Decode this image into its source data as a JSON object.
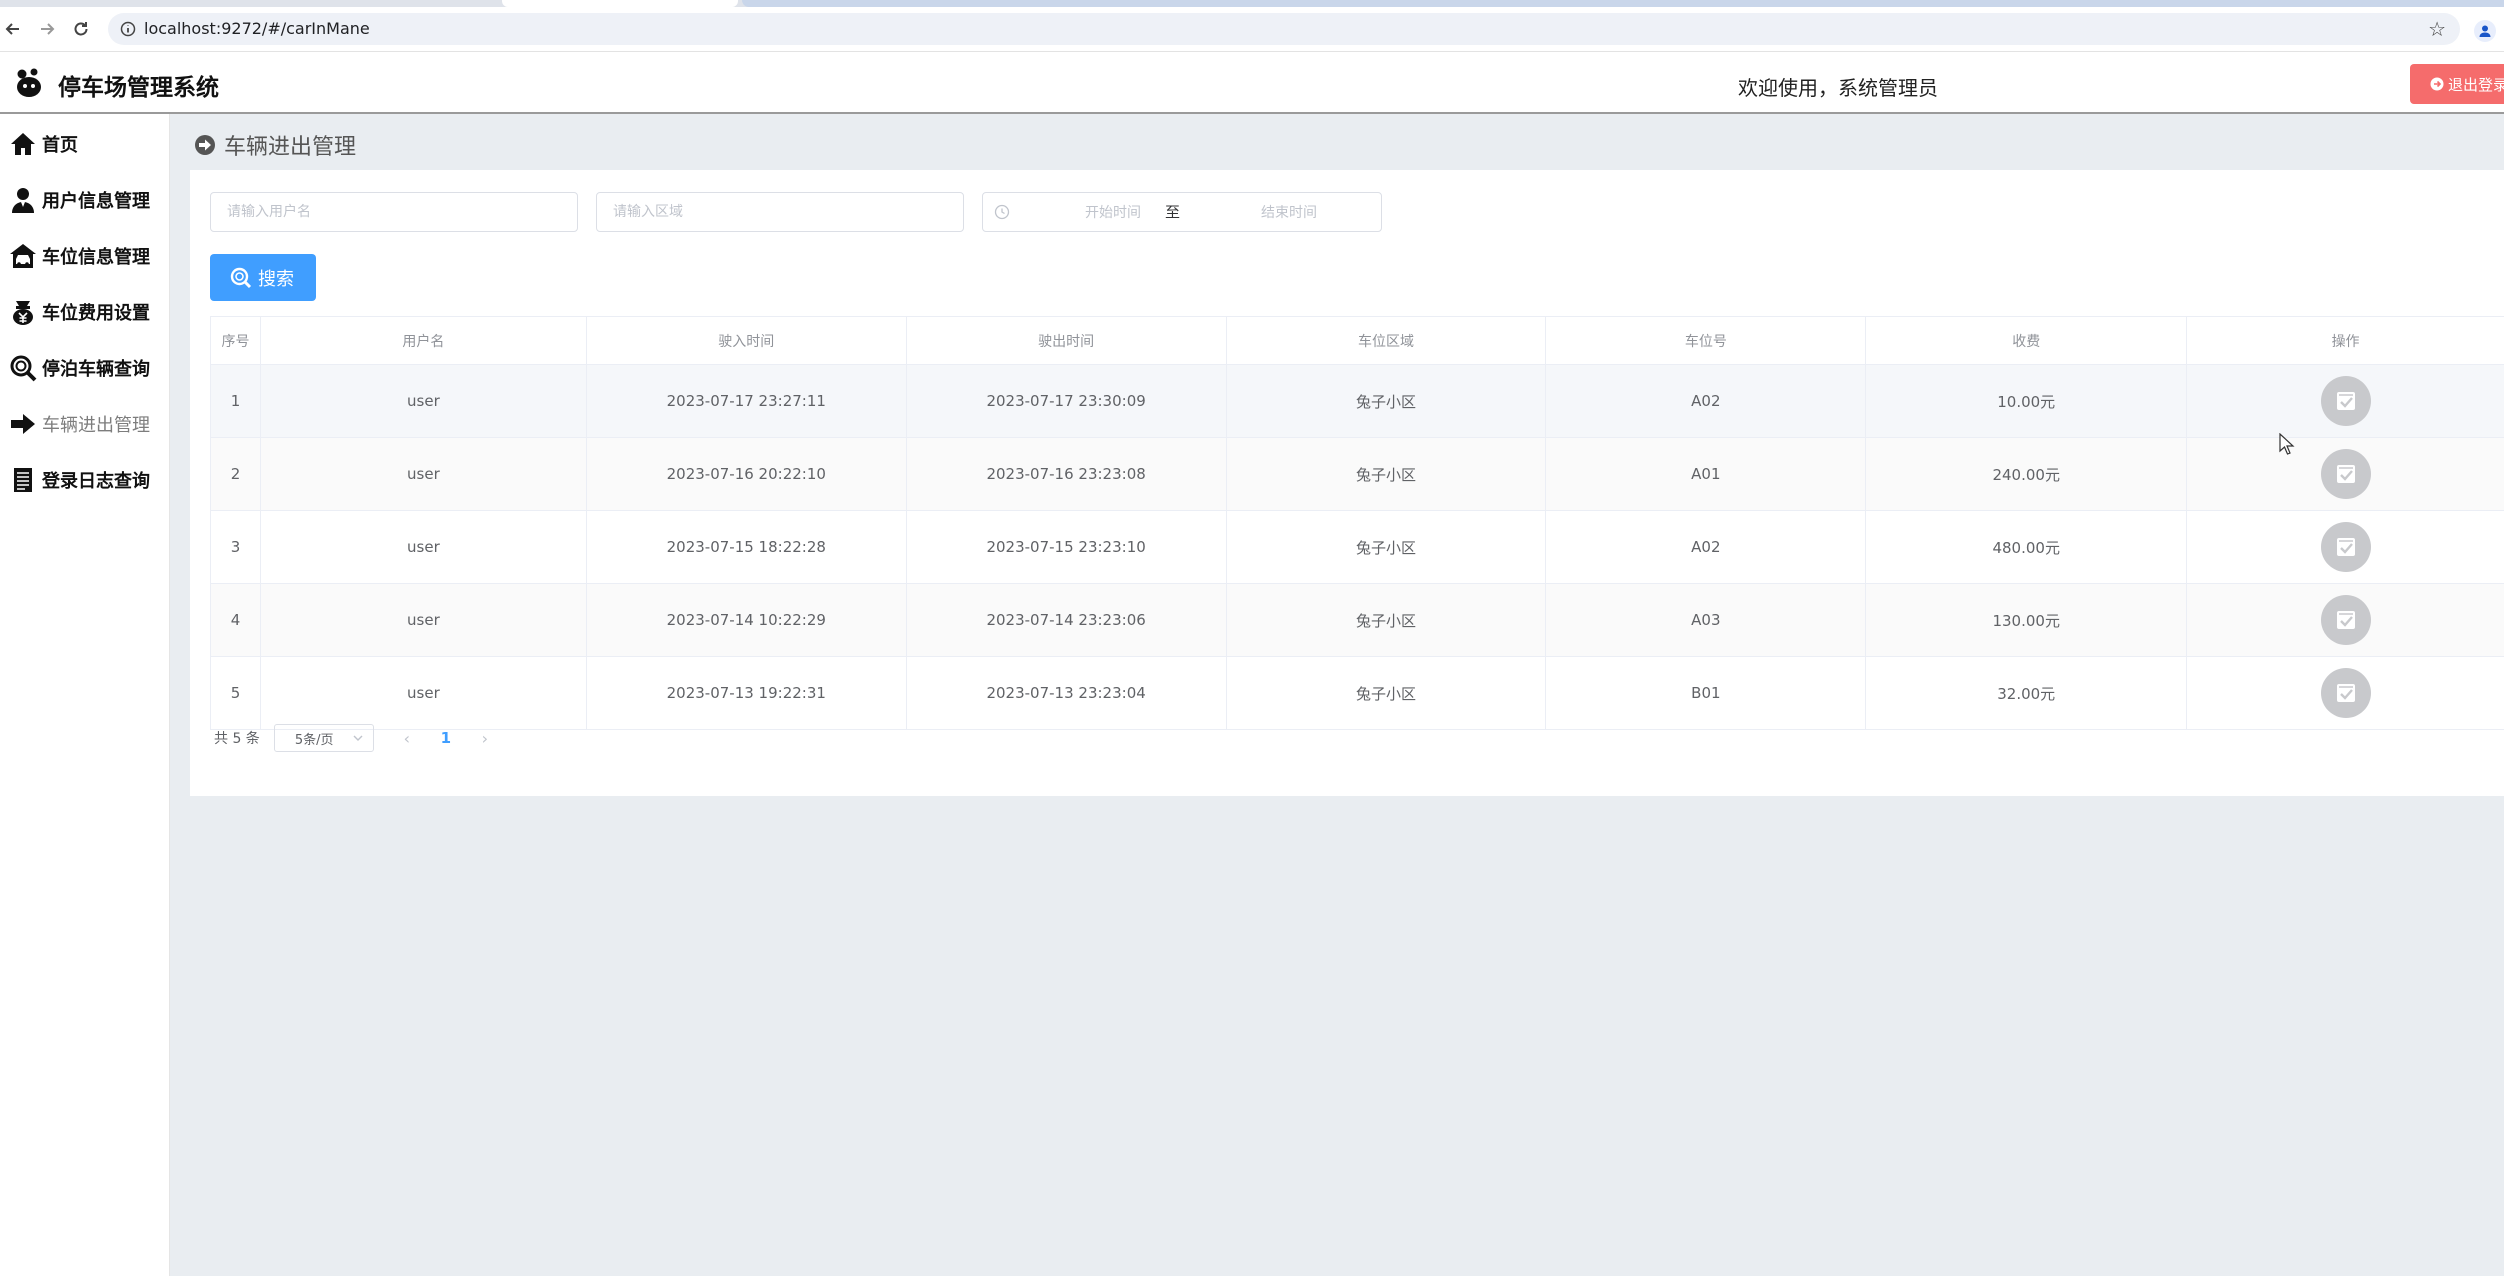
{
  "browser": {
    "url": "localhost:9272/#/carInMane"
  },
  "header": {
    "title": "停车场管理系统",
    "welcome": "欢迎使用，系统管理员",
    "logout_label": "退出登录"
  },
  "sidebar": {
    "items": [
      {
        "label": "首页",
        "icon": "home-icon"
      },
      {
        "label": "用户信息管理",
        "icon": "user-icon"
      },
      {
        "label": "车位信息管理",
        "icon": "parking-spot-icon"
      },
      {
        "label": "车位费用设置",
        "icon": "fee-icon"
      },
      {
        "label": "停泊车辆查询",
        "icon": "search-icon"
      },
      {
        "label": "车辆进出管理",
        "icon": "arrow-right-icon",
        "active": true
      },
      {
        "label": "登录日志查询",
        "icon": "log-icon"
      }
    ]
  },
  "page": {
    "title": "车辆进出管理"
  },
  "filters": {
    "username_placeholder": "请输入用户名",
    "area_placeholder": "请输入区域",
    "start_placeholder": "开始时间",
    "range_separator": "至",
    "end_placeholder": "结束时间",
    "search_label": "搜索"
  },
  "table": {
    "columns": [
      "序号",
      "用户名",
      "驶入时间",
      "驶出时间",
      "车位区域",
      "车位号",
      "收费",
      "操作"
    ],
    "rows": [
      {
        "index": "1",
        "username": "user",
        "in_time": "2023-07-17 23:27:11",
        "out_time": "2023-07-17 23:30:09",
        "area": "兔子小区",
        "spot": "A02",
        "fee": "10.00元"
      },
      {
        "index": "2",
        "username": "user",
        "in_time": "2023-07-16 20:22:10",
        "out_time": "2023-07-16 23:23:08",
        "area": "兔子小区",
        "spot": "A01",
        "fee": "240.00元"
      },
      {
        "index": "3",
        "username": "user",
        "in_time": "2023-07-15 18:22:28",
        "out_time": "2023-07-15 23:23:10",
        "area": "兔子小区",
        "spot": "A02",
        "fee": "480.00元"
      },
      {
        "index": "4",
        "username": "user",
        "in_time": "2023-07-14 10:22:29",
        "out_time": "2023-07-14 23:23:06",
        "area": "兔子小区",
        "spot": "A03",
        "fee": "130.00元"
      },
      {
        "index": "5",
        "username": "user",
        "in_time": "2023-07-13 19:22:31",
        "out_time": "2023-07-13 23:23:04",
        "area": "兔子小区",
        "spot": "B01",
        "fee": "32.00元"
      }
    ]
  },
  "pagination": {
    "total": "共 5 条",
    "page_size": "5条/页",
    "current_page": "1"
  },
  "colors": {
    "primary": "#409eff",
    "danger": "#f56c6c",
    "background": "#e9edf1"
  }
}
